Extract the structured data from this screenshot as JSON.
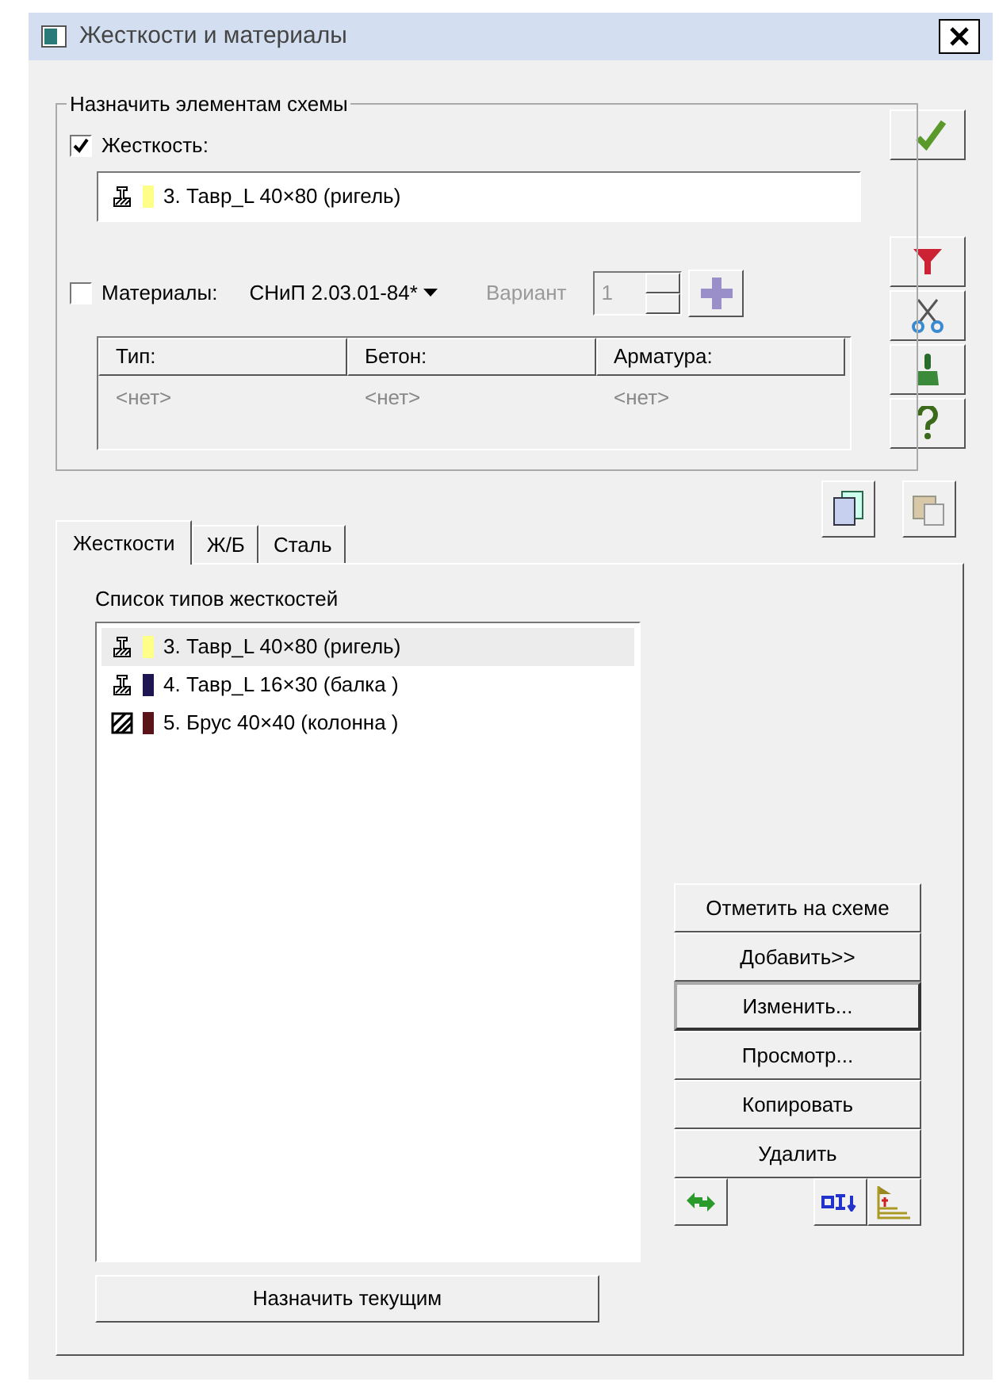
{
  "window": {
    "title": "Жесткости и материалы"
  },
  "assign_group": {
    "title": "Назначить элементам схемы",
    "stiffness": {
      "label": "Жесткость:",
      "checked": true,
      "value": {
        "text": "3. Тавр_L 40×80 (ригель)",
        "color": "#ffff88",
        "kind": "tee"
      }
    },
    "materials": {
      "label": "Материалы:",
      "checked": false,
      "norm": "СНиП 2.03.01-84*",
      "variant_label": "Вариант",
      "variant": "1",
      "disabled": true
    },
    "table": {
      "columns": [
        "Тип:",
        "Бетон:",
        "Арматура:"
      ],
      "rows": [
        [
          "<нет>",
          "<нет>",
          "<нет>"
        ]
      ]
    }
  },
  "tabs": [
    {
      "label": "Жесткости",
      "selected": true
    },
    {
      "label": "Ж/Б",
      "selected": false
    },
    {
      "label": "Сталь",
      "selected": false
    }
  ],
  "list_label": "Список типов жесткостей",
  "list": [
    {
      "text": "3. Тавр_L 40×80 (ригель)",
      "color": "#ffff88",
      "kind": "tee",
      "selected": true
    },
    {
      "text": "4. Тавр_L 16×30 (балка )",
      "color": "#1e1650",
      "kind": "tee",
      "selected": false
    },
    {
      "text": "5. Брус 40×40 (колонна )",
      "color": "#5a1418",
      "kind": "bar",
      "selected": false
    }
  ],
  "buttons": [
    {
      "label": "Отметить на схеме",
      "default": false
    },
    {
      "label": "Добавить>>",
      "default": false
    },
    {
      "label": "Изменить...",
      "default": true
    },
    {
      "label": "Просмотр...",
      "default": false
    },
    {
      "label": "Копировать",
      "default": false
    },
    {
      "label": "Удалить",
      "default": false
    }
  ],
  "assign_current": "Назначить текущим"
}
